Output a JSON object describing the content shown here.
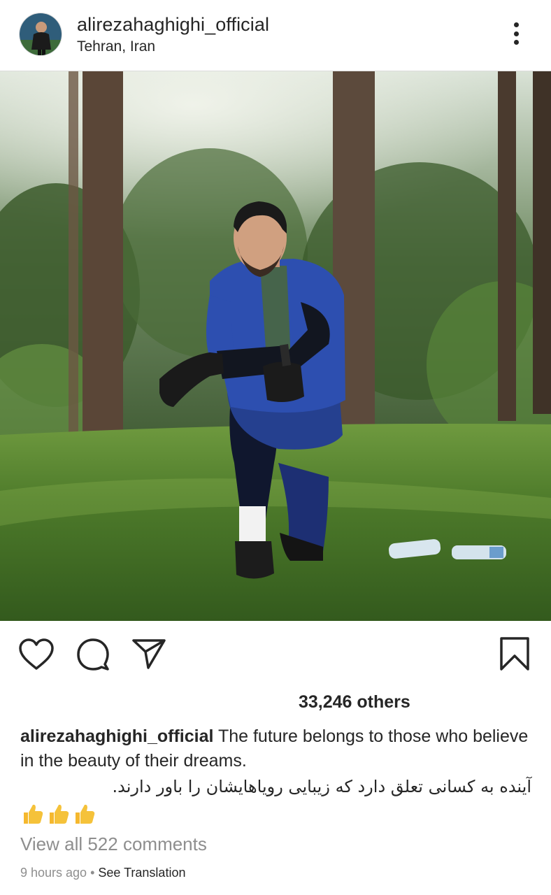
{
  "post": {
    "username": "alirezahaghighi_official",
    "location": "Tehran, Iran",
    "likes_text": "33,246 others",
    "caption_user": "alirezahaghighi_official",
    "caption_text": " The future belongs to those who believe in the beauty of their dreams.",
    "caption_fa": "آینده به کسانی تعلق دارد که زیبایی رویاهایشان را باور دارند.",
    "emojis": [
      "thumbs-up",
      "thumbs-up",
      "thumbs-up"
    ],
    "view_comments": "View all 522 comments",
    "time_ago": "9 hours ago",
    "separator": " • ",
    "see_translation": "See Translation"
  },
  "icons": {
    "more": "more-vertical-icon",
    "like": "heart-icon",
    "comment": "comment-icon",
    "share": "send-icon",
    "save": "bookmark-icon"
  },
  "colors": {
    "text": "#262626",
    "secondary": "#8e8e8e",
    "border": "#dbdbdb"
  }
}
